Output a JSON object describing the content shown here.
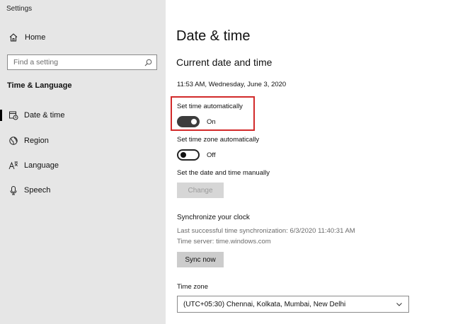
{
  "app": {
    "title": "Settings"
  },
  "sidebar": {
    "home_label": "Home",
    "search_placeholder": "Find a setting",
    "section_title": "Time & Language",
    "items": [
      {
        "label": "Date & time",
        "icon": "calendar-clock-icon",
        "selected": true
      },
      {
        "label": "Region",
        "icon": "globe-icon",
        "selected": false
      },
      {
        "label": "Language",
        "icon": "language-icon",
        "selected": false
      },
      {
        "label": "Speech",
        "icon": "microphone-icon",
        "selected": false
      }
    ]
  },
  "main": {
    "title": "Date & time",
    "section_title": "Current date and time",
    "current_datetime": "11:53 AM, Wednesday, June 3, 2020",
    "set_time_auto": {
      "label": "Set time automatically",
      "state": "On",
      "on": true
    },
    "set_timezone_auto": {
      "label": "Set time zone automatically",
      "state": "Off",
      "on": false
    },
    "manual": {
      "label": "Set the date and time manually",
      "button": "Change"
    },
    "sync": {
      "title": "Synchronize your clock",
      "last_sync": "Last successful time synchronization: 6/3/2020 11:40:31 AM",
      "server": "Time server: time.windows.com",
      "button": "Sync now"
    },
    "timezone": {
      "label": "Time zone",
      "value": "(UTC+05:30) Chennai, Kolkata, Mumbai, New Delhi"
    }
  },
  "colors": {
    "sidebar_bg": "#e6e6e6",
    "highlight": "#d22a2a",
    "toggle_on": "#3c3c3c"
  }
}
